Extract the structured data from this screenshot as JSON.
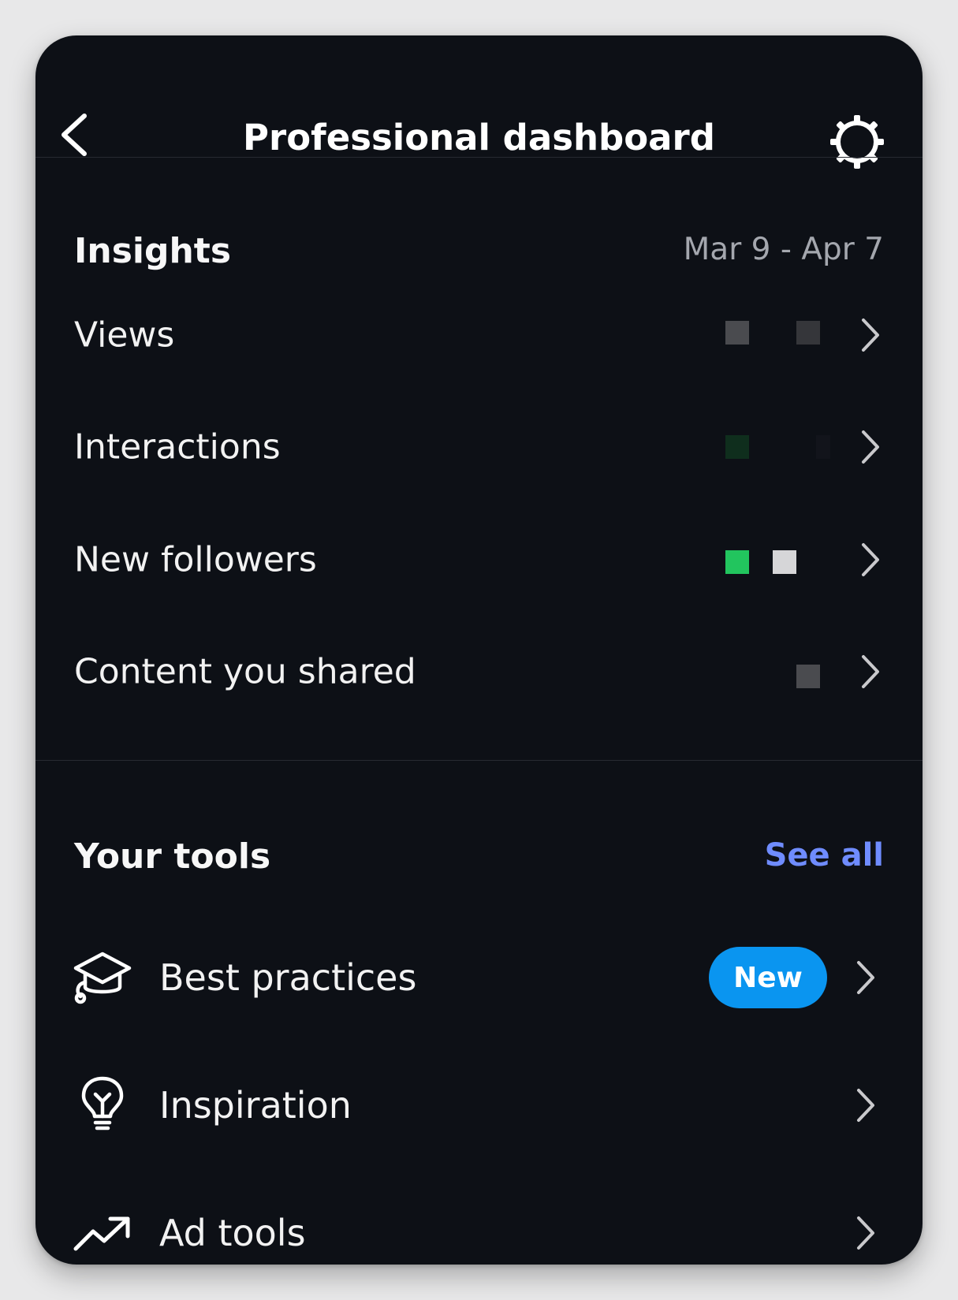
{
  "header": {
    "title": "Professional dashboard",
    "back_icon": "chevron-left-icon",
    "settings_icon": "gear-icon"
  },
  "insights": {
    "title": "Insights",
    "date_range": "Mar 9 - Apr 7",
    "rows": [
      {
        "label": "Views",
        "value_icon": "redacted-value"
      },
      {
        "label": "Interactions",
        "value_icon": "redacted-value"
      },
      {
        "label": "New followers",
        "value_icon": "redacted-value"
      },
      {
        "label": "Content you shared",
        "value_icon": "redacted-value"
      }
    ]
  },
  "tools": {
    "title": "Your tools",
    "see_all": "See all",
    "items": [
      {
        "label": "Best practices",
        "icon": "graduation-cap-icon",
        "badge": "New"
      },
      {
        "label": "Inspiration",
        "icon": "lightbulb-icon"
      },
      {
        "label": "Ad tools",
        "icon": "trending-up-icon"
      }
    ]
  },
  "colors": {
    "background": "#0d1016",
    "accent_link": "#6f8cff",
    "badge": "#0a95f0",
    "positive": "#22c55e"
  }
}
